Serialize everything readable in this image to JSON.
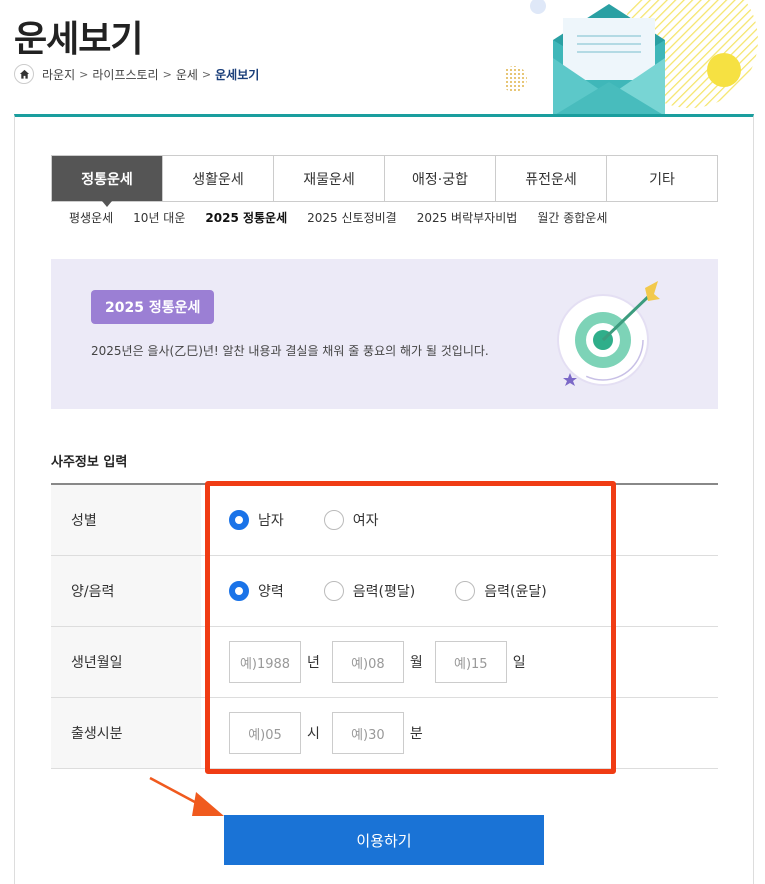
{
  "page": {
    "title": "운세보기"
  },
  "breadcrumb": {
    "home_icon": "home-icon",
    "items": [
      "라운지",
      "라이프스토리",
      "운세",
      "운세보기"
    ]
  },
  "tabs": [
    {
      "label": "정통운세",
      "active": true
    },
    {
      "label": "생활운세",
      "active": false
    },
    {
      "label": "재물운세",
      "active": false
    },
    {
      "label": "애정·궁합",
      "active": false
    },
    {
      "label": "퓨전운세",
      "active": false
    },
    {
      "label": "기타",
      "active": false
    }
  ],
  "subtabs": [
    {
      "label": "평생운세",
      "active": false
    },
    {
      "label": "10년 대운",
      "active": false
    },
    {
      "label": "2025 정통운세",
      "active": true
    },
    {
      "label": "2025 신토정비결",
      "active": false
    },
    {
      "label": "2025 벼락부자비법",
      "active": false
    },
    {
      "label": "월간 종합운세",
      "active": false
    }
  ],
  "banner": {
    "badge": "2025 정통운세",
    "description": "2025년은 을사(乙巳)년! 알찬 내용과 결실을 채워 줄 풍요의 해가 될 것입니다.",
    "icon": "target-arrow-icon"
  },
  "form": {
    "section_title": "사주정보 입력",
    "gender": {
      "label": "성별",
      "options": [
        {
          "label": "남자",
          "checked": true
        },
        {
          "label": "여자",
          "checked": false
        }
      ]
    },
    "calendar": {
      "label": "양/음력",
      "options": [
        {
          "label": "양력",
          "checked": true
        },
        {
          "label": "음력(평달)",
          "checked": false
        },
        {
          "label": "음력(윤달)",
          "checked": false
        }
      ]
    },
    "birthdate": {
      "label": "생년월일",
      "year_placeholder": "예)1988",
      "year_unit": "년",
      "month_placeholder": "예)08",
      "month_unit": "월",
      "day_placeholder": "예)15",
      "day_unit": "일"
    },
    "birthtime": {
      "label": "출생시분",
      "hour_placeholder": "예)05",
      "hour_unit": "시",
      "minute_placeholder": "예)30",
      "minute_unit": "분"
    },
    "submit_label": "이용하기"
  },
  "colors": {
    "accent_teal": "#1a9e9e",
    "active_tab": "#555555",
    "banner_bg": "#eceaf7",
    "badge": "#9b7fd4",
    "radio_checked": "#1a73e8",
    "submit": "#1a73d6",
    "highlight": "#f03c14"
  }
}
